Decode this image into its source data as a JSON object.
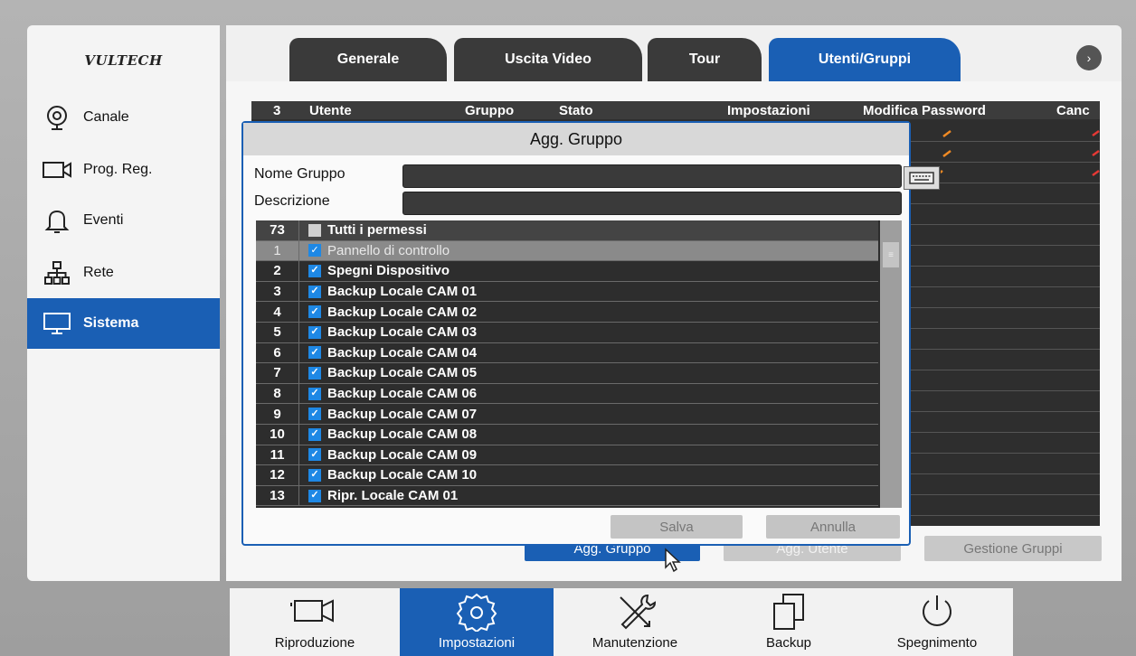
{
  "brand": {
    "logo_text": "VULTECH"
  },
  "sidebar": {
    "items": [
      {
        "label": "Canale",
        "icon": "camera-icon"
      },
      {
        "label": "Prog. Reg.",
        "icon": "video-camera-icon"
      },
      {
        "label": "Eventi",
        "icon": "bell-icon"
      },
      {
        "label": "Rete",
        "icon": "network-icon"
      },
      {
        "label": "Sistema",
        "icon": "monitor-icon",
        "active": true
      }
    ]
  },
  "tabs": [
    {
      "label": "Generale"
    },
    {
      "label": "Uscita Video"
    },
    {
      "label": "Tour"
    },
    {
      "label": "Utenti/Gruppi",
      "active": true
    }
  ],
  "tab_next_glyph": "›",
  "users_table": {
    "count": "3",
    "columns": [
      "Utente",
      "Gruppo",
      "Stato",
      "Impostazioni",
      "Modifica Password",
      "Canc"
    ]
  },
  "bottom_buttons": {
    "add_group": "Agg. Gruppo",
    "add_user": "Agg. Utente",
    "manage_groups": "Gestione Gruppi"
  },
  "dialog": {
    "title": "Agg. Gruppo",
    "group_name_label": "Nome Gruppo",
    "group_name_value": "",
    "description_label": "Descrizione",
    "description_value": "",
    "permissions_total": "73",
    "all_permissions_label": "Tutti i permessi",
    "permissions": [
      {
        "num": "1",
        "label": "Pannello di controllo",
        "checked": true,
        "highlighted": true
      },
      {
        "num": "2",
        "label": "Spegni Dispositivo",
        "checked": true
      },
      {
        "num": "3",
        "label": "Backup Locale CAM 01",
        "checked": true
      },
      {
        "num": "4",
        "label": "Backup Locale CAM 02",
        "checked": true
      },
      {
        "num": "5",
        "label": "Backup Locale CAM 03",
        "checked": true
      },
      {
        "num": "6",
        "label": "Backup Locale CAM 04",
        "checked": true
      },
      {
        "num": "7",
        "label": "Backup Locale CAM 05",
        "checked": true
      },
      {
        "num": "8",
        "label": "Backup Locale CAM 06",
        "checked": true
      },
      {
        "num": "9",
        "label": "Backup Locale CAM 07",
        "checked": true
      },
      {
        "num": "10",
        "label": "Backup Locale CAM 08",
        "checked": true
      },
      {
        "num": "11",
        "label": "Backup Locale CAM 09",
        "checked": true
      },
      {
        "num": "12",
        "label": "Backup Locale CAM 10",
        "checked": true
      },
      {
        "num": "13",
        "label": "Ripr. Locale CAM 01",
        "checked": true
      }
    ],
    "save_label": "Salva",
    "cancel_label": "Annulla"
  },
  "dock": [
    {
      "label": "Riproduzione",
      "icon": "playback-camera-icon"
    },
    {
      "label": "Impostazioni",
      "icon": "settings-gear-icon",
      "active": true
    },
    {
      "label": "Manutenzione",
      "icon": "tools-icon"
    },
    {
      "label": "Backup",
      "icon": "copy-files-icon"
    },
    {
      "label": "Spegnimento",
      "icon": "power-icon"
    }
  ],
  "colors": {
    "accent": "#1a5fb4",
    "panel_dark": "#2e2e2e",
    "checkbox": "#1e88e5",
    "edit_marker": "#f08a24",
    "delete_marker": "#e53935"
  }
}
